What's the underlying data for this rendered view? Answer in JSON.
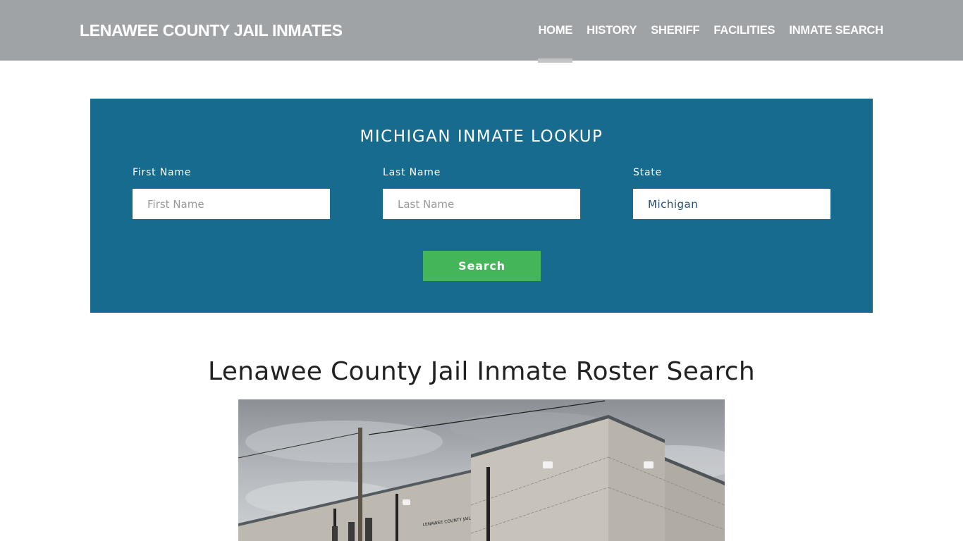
{
  "header": {
    "brand": "LENAWEE COUNTY JAIL INMATES",
    "nav": [
      {
        "label": "HOME",
        "active": true
      },
      {
        "label": "HISTORY",
        "active": false
      },
      {
        "label": "SHERIFF",
        "active": false
      },
      {
        "label": "FACILITIES",
        "active": false
      },
      {
        "label": "INMATE SEARCH",
        "active": false
      }
    ]
  },
  "lookup": {
    "title": "MICHIGAN INMATE LOOKUP",
    "first_name": {
      "label": "First Name",
      "placeholder": "First Name",
      "value": ""
    },
    "last_name": {
      "label": "Last Name",
      "placeholder": "Last Name",
      "value": ""
    },
    "state": {
      "label": "State",
      "value": "Michigan"
    },
    "search_label": "Search"
  },
  "main": {
    "title": "Lenawee County Jail Inmate Roster Search",
    "photo": {
      "alt": "Lenawee County Jail building exterior",
      "sign_text": "LENAWEE COUNTY JAIL"
    }
  },
  "colors": {
    "header_bg": "#9fa3a6",
    "panel_bg": "#176b8e",
    "button_bg": "#45b55a"
  }
}
